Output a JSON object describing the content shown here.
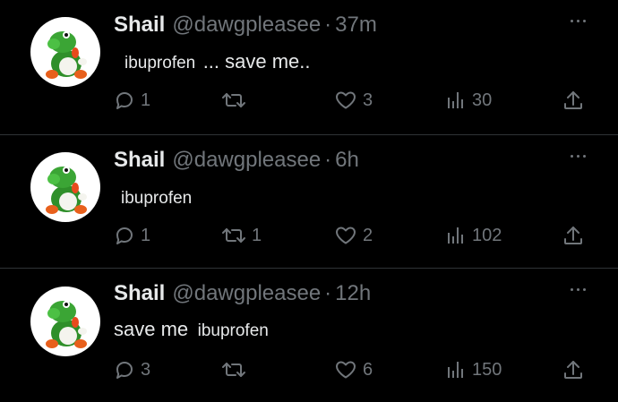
{
  "tweets": [
    {
      "name": "Shail",
      "handle": "@dawgpleasee",
      "separator": "·",
      "time": "37m",
      "body_ibuprofen": "ibuprofen",
      "body_main": "... save me..",
      "reply_count": "1",
      "retweet_count": "",
      "like_count": "3",
      "view_count": "30"
    },
    {
      "name": "Shail",
      "handle": "@dawgpleasee",
      "separator": "·",
      "time": "6h",
      "body_ibuprofen": "ibuprofen",
      "body_main": "",
      "reply_count": "1",
      "retweet_count": "1",
      "like_count": "2",
      "view_count": "102"
    },
    {
      "name": "Shail",
      "handle": "@dawgpleasee",
      "separator": "·",
      "time": "12h",
      "body_ibuprofen": "ibuprofen",
      "body_main": "save me",
      "reply_count": "3",
      "retweet_count": "",
      "like_count": "6",
      "view_count": "150"
    }
  ],
  "icons": {
    "avatar": "yoshi-avatar",
    "more": "more-horizontal-icon",
    "reply": "reply-icon",
    "retweet": "retweet-icon",
    "like": "heart-icon",
    "views": "views-chart-icon",
    "share": "share-icon"
  },
  "colors": {
    "background": "#000000",
    "text_primary": "#e7e9ea",
    "text_secondary": "#71767b",
    "divider": "#2f3336"
  }
}
